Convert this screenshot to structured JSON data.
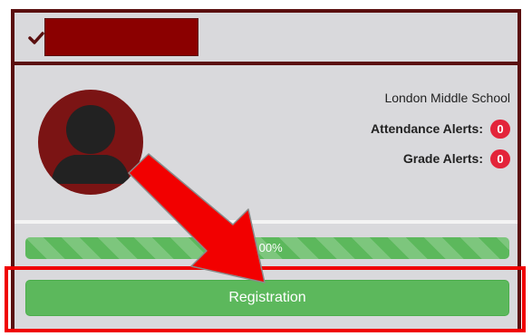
{
  "student": {
    "school": "London Middle School",
    "attendance_alerts_label": "Attendance Alerts:",
    "attendance_alerts_count": "0",
    "grade_alerts_label": "Grade Alerts:",
    "grade_alerts_count": "0"
  },
  "progress": {
    "label": "100%",
    "fraction": 1.0
  },
  "actions": {
    "registration_label": "Registration"
  },
  "colors": {
    "card_border": "#5a0f0f",
    "name_redaction": "#8b0000",
    "success": "#5cb85c",
    "alert_badge": "#e3243a",
    "annotation": "#f00000"
  },
  "icons": {
    "header": "check-icon",
    "avatar": "person-silhouette-icon",
    "annotation": "arrow-annotation"
  }
}
